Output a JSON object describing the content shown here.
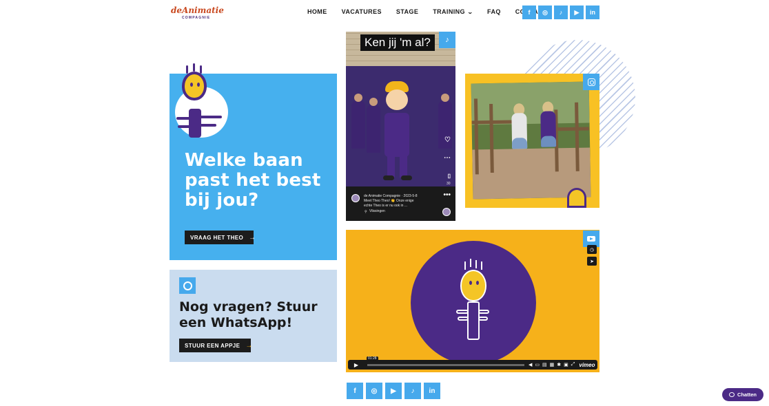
{
  "header": {
    "logo_line1": "deAnimatie",
    "logo_line2": "COMPAGNIE",
    "nav": [
      {
        "label": "HOME"
      },
      {
        "label": "VACATURES"
      },
      {
        "label": "STAGE"
      },
      {
        "label": "TRAINING",
        "has_dropdown": true
      },
      {
        "label": "FAQ"
      },
      {
        "label": "CONTACT"
      }
    ],
    "social": [
      {
        "icon": "facebook-icon",
        "glyph": "f"
      },
      {
        "icon": "instagram-icon",
        "glyph": "◎"
      },
      {
        "icon": "tiktok-icon",
        "glyph": "♪"
      },
      {
        "icon": "youtube-icon",
        "glyph": "▶"
      },
      {
        "icon": "linkedin-icon",
        "glyph": "in"
      }
    ]
  },
  "job_card": {
    "title": "Welke baan past het best bij jou?",
    "button_label": "VRAAG HET THEO",
    "arrow": "→",
    "background": "#46b0ee"
  },
  "whatsapp_card": {
    "title": "Nog vragen? Stuur een WhatsApp!",
    "button_label": "STUUR EEN APPJE",
    "arrow": "→",
    "background": "#cadcef"
  },
  "tiktok_post": {
    "caption": "Ken jij 'm al?",
    "author_line": "de Animatie Compagnie · 2023-5-8",
    "text_line1": "Meet Theo Theo! 👏 Onze enige",
    "text_line2": "echte Theo is er nu ook in ...",
    "location": "Vlissingen",
    "count": "30",
    "badge_glyph": "♪"
  },
  "video": {
    "time": "01:28",
    "brand": "vimeo",
    "background": "#f6b11a"
  },
  "bottom_social": [
    {
      "icon": "facebook-icon",
      "glyph": "f"
    },
    {
      "icon": "instagram-icon",
      "glyph": "◎"
    },
    {
      "icon": "youtube-icon",
      "glyph": "▶"
    },
    {
      "icon": "tiktok-icon",
      "glyph": "♪"
    },
    {
      "icon": "linkedin-icon",
      "glyph": "in"
    }
  ],
  "chat": {
    "label": "Chatten"
  },
  "colors": {
    "accent": "#46a9ec",
    "purple": "#4b2a86",
    "yellow": "#f8c124",
    "dark": "#1c1c1c"
  }
}
